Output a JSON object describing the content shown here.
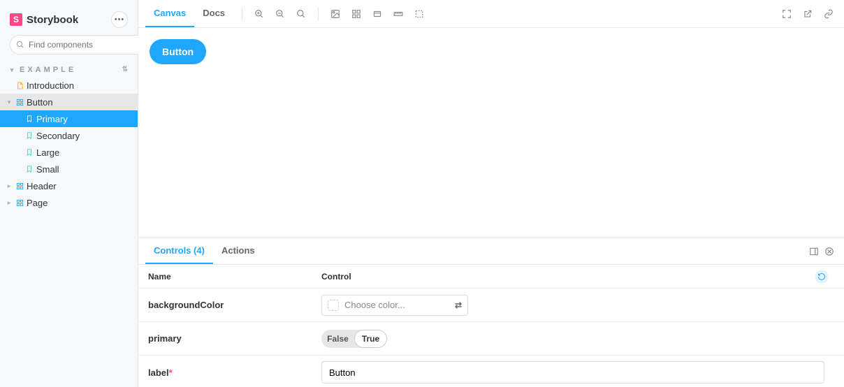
{
  "brand": {
    "name": "Storybook",
    "logo_letter": "S"
  },
  "search": {
    "placeholder": "Find components",
    "shortcut": "/"
  },
  "section": {
    "title": "EXAMPLE"
  },
  "tree": {
    "introduction": "Introduction",
    "button": "Button",
    "button_stories": {
      "primary": "Primary",
      "secondary": "Secondary",
      "large": "Large",
      "small": "Small"
    },
    "header": "Header",
    "page": "Page"
  },
  "toolbar": {
    "tabs": {
      "canvas": "Canvas",
      "docs": "Docs"
    }
  },
  "preview": {
    "button_label": "Button"
  },
  "addons": {
    "tabs": {
      "controls": "Controls (4)",
      "actions": "Actions"
    },
    "columns": {
      "name": "Name",
      "control": "Control"
    },
    "rows": {
      "backgroundColor": {
        "name": "backgroundColor",
        "placeholder": "Choose color..."
      },
      "primary": {
        "name": "primary",
        "false": "False",
        "true": "True",
        "value": true
      },
      "label": {
        "name": "label",
        "required": "*",
        "value": "Button"
      }
    }
  }
}
